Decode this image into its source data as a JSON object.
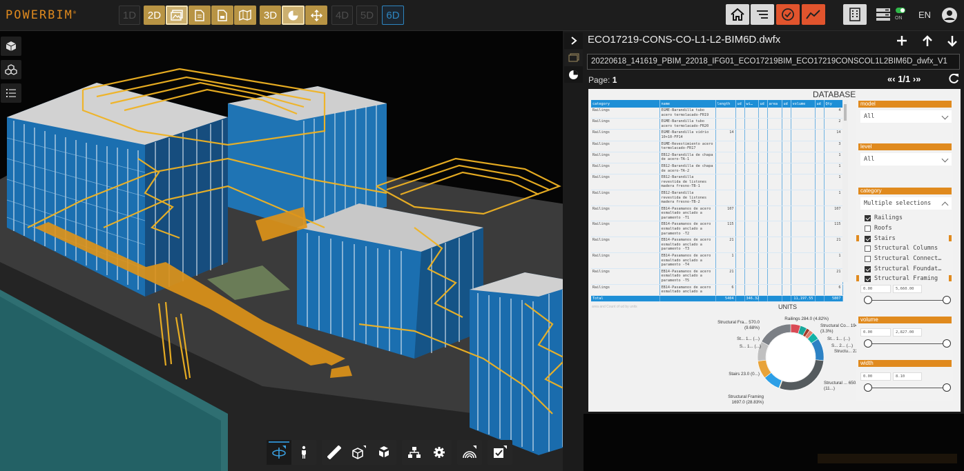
{
  "app": {
    "logo": "POWERBIM",
    "logo_mark": "®"
  },
  "toolbar": {
    "dim_1d": "1D",
    "dim_2d": "2D",
    "dim_3d": "3D",
    "dim_4d": "4D",
    "dim_5d": "5D",
    "dim_6d": "6D",
    "toggle_label": "ON",
    "language": "EN"
  },
  "panel": {
    "file_title": "ECO17219-CONS-CO-L1-L2-BIM6D.dwfx",
    "file_name": "20220618_141619_PBIM_22018_IFG01_ECO17219BIM_ECO17219CONSCOL1L2BIM6D_dwfx_V1",
    "page_label": "Page:",
    "page_number": "1",
    "pager_text": "1/1",
    "pager_first": "«",
    "pager_prev": "‹",
    "pager_next": "›",
    "pager_last": "»"
  },
  "report": {
    "title": "DATABASE",
    "columns": [
      "category",
      "name",
      "length",
      "ud",
      "wi…",
      "ud",
      "area",
      "ud",
      "volume",
      "ud",
      "Qty"
    ],
    "rows": [
      {
        "category": "Railings",
        "name": "EGME-Barandilla tubo acero termolacado-FR19",
        "length": "",
        "qty": "4"
      },
      {
        "category": "Railings",
        "name": "EGME-Barandilla tubo acero termolacado-FR20",
        "length": "",
        "qty": "2"
      },
      {
        "category": "Railings",
        "name": "EGME-Barandilla vidrio 10+10-FP14",
        "length": "14",
        "qty": "14"
      },
      {
        "category": "Railings",
        "name": "EGME-Revestimiento acero termolacado-FR17",
        "length": "",
        "qty": "3"
      },
      {
        "category": "Railings",
        "name": "EB12-Barandilla de chapa de acero-TA-1",
        "length": "",
        "qty": "1"
      },
      {
        "category": "Railings",
        "name": "EB12-Barandilla de chapa de acero-TA-2",
        "length": "",
        "qty": "1"
      },
      {
        "category": "Railings",
        "name": "EB12-Barandilla revestida de listones madera fresno-TB-1",
        "length": "",
        "qty": "1"
      },
      {
        "category": "Railings",
        "name": "EB12-Barandilla revestida de listones madera fresno-TB-2",
        "length": "",
        "qty": "1"
      },
      {
        "category": "Railings",
        "name": "EB14-Pasamanos de acero esmaltado anclado a paramento -T1",
        "length": "107",
        "qty": "107"
      },
      {
        "category": "Railings",
        "name": "EB14-Pasamanos de acero esmaltado anclado a paramento -T2",
        "length": "115",
        "qty": "115"
      },
      {
        "category": "Railings",
        "name": "EB14-Pasamanos de acero esmaltado anclado a paramento -T3",
        "length": "21",
        "qty": "21"
      },
      {
        "category": "Railings",
        "name": "EB14-Pasamanos de acero esmaltado anclado a paramento -T4",
        "length": "1",
        "qty": "1"
      },
      {
        "category": "Railings",
        "name": "EB14-Pasamanos de acero esmaltado anclado a paramento -T5",
        "length": "21",
        "qty": "21"
      },
      {
        "category": "Railings",
        "name": "EB14-Pasamanos de acero esmaltado anclado a",
        "length": "6",
        "qty": "6"
      }
    ],
    "total": {
      "label": "Total",
      "length": "5404",
      "width": "346.32",
      "volume": "11,197.55",
      "qty": "5807"
    },
    "faint_caption": "area and Count of ud by units",
    "units_title": "UNITS"
  },
  "slicers": {
    "model": {
      "label": "model",
      "value": "All"
    },
    "level": {
      "label": "level",
      "value": "All"
    },
    "category": {
      "label": "category",
      "value": "Multiple selections",
      "items": [
        {
          "label": "Railings",
          "checked": true
        },
        {
          "label": "Roofs",
          "checked": false
        },
        {
          "label": "Stairs",
          "checked": true
        },
        {
          "label": "Structural Columns",
          "checked": false
        },
        {
          "label": "Structural Connect…",
          "checked": false
        },
        {
          "label": "Structural Foundat…",
          "checked": true
        },
        {
          "label": "Structural Framing",
          "checked": true
        }
      ]
    },
    "length_range": {
      "min": "0.00",
      "max": "5,660.00"
    },
    "volume": {
      "label": "volume",
      "min": "0.00",
      "max": "2,827.00"
    },
    "width": {
      "label": "width",
      "min": "0.00",
      "max": "8.10"
    }
  },
  "chart_data": {
    "type": "pie",
    "title": "UNITS",
    "variant": "donut",
    "labels": [
      {
        "text": "Railings 284.0 (4.82%)"
      },
      {
        "text": "Structural Co... 194.0 (3.3%)"
      },
      {
        "text": "St... 1... (...)"
      },
      {
        "text": "S... 2... (...)"
      },
      {
        "text": "Structu... 22... (...)"
      },
      {
        "text": "Structural ... 650.0 (11...)"
      },
      {
        "text": "Structural Framing 1697.0 (28.83%)"
      },
      {
        "text": "Stairs 23.0 (0...)"
      },
      {
        "text": "S... 1... (...)"
      },
      {
        "text": "St... 1... (...)"
      },
      {
        "text": "Structural Fra... 570.0 (9.68%)"
      }
    ],
    "slices": [
      {
        "name": "Railings",
        "value": 284.0,
        "percent": 4.82,
        "color": "#d94a55"
      },
      {
        "name": "Structural Co...",
        "value": 194.0,
        "percent": 3.3,
        "color": "#1aa79b"
      },
      {
        "name": "St...",
        "value": 100,
        "percent": 1.7,
        "color": "#a33c2b"
      },
      {
        "name": "S...",
        "value": 120,
        "percent": 2.0,
        "color": "#e07c6a"
      },
      {
        "name": "Structu...",
        "value": 220,
        "percent": 3.7,
        "color": "#14b2a6"
      },
      {
        "name": "Structural ...",
        "value": 650.0,
        "percent": 11.0,
        "color": "#2d82c4"
      },
      {
        "name": "Structural Framing",
        "value": 1697.0,
        "percent": 28.83,
        "color": "#555b5e"
      },
      {
        "name": "Stairs",
        "value": 23.0,
        "percent": 0.4,
        "color": "#d9c27a"
      },
      {
        "name": "S...",
        "value": 500,
        "percent": 8.5,
        "color": "#2d9fe6"
      },
      {
        "name": "St...",
        "value": 520,
        "percent": 8.8,
        "color": "#e8a33a"
      },
      {
        "name": "Structural Fra...",
        "value": 570.0,
        "percent": 9.68,
        "color": "#c0c0c0"
      },
      {
        "name": "other",
        "value": 1010,
        "percent": 17.3,
        "color": "#7b7f85"
      }
    ]
  },
  "colors": {
    "accent": "#e08a1e",
    "gold": "#b89444",
    "blue": "#2e86c1",
    "red": "#e1542d"
  },
  "icons": {
    "left": [
      "cube-icon",
      "components-icon",
      "list-icon"
    ],
    "bottom": [
      "orbit-icon",
      "walk-icon",
      "measure-icon",
      "section-box-icon",
      "explode-icon",
      "tree-icon",
      "settings-icon",
      "rainbow-icon",
      "checklist-icon"
    ]
  }
}
